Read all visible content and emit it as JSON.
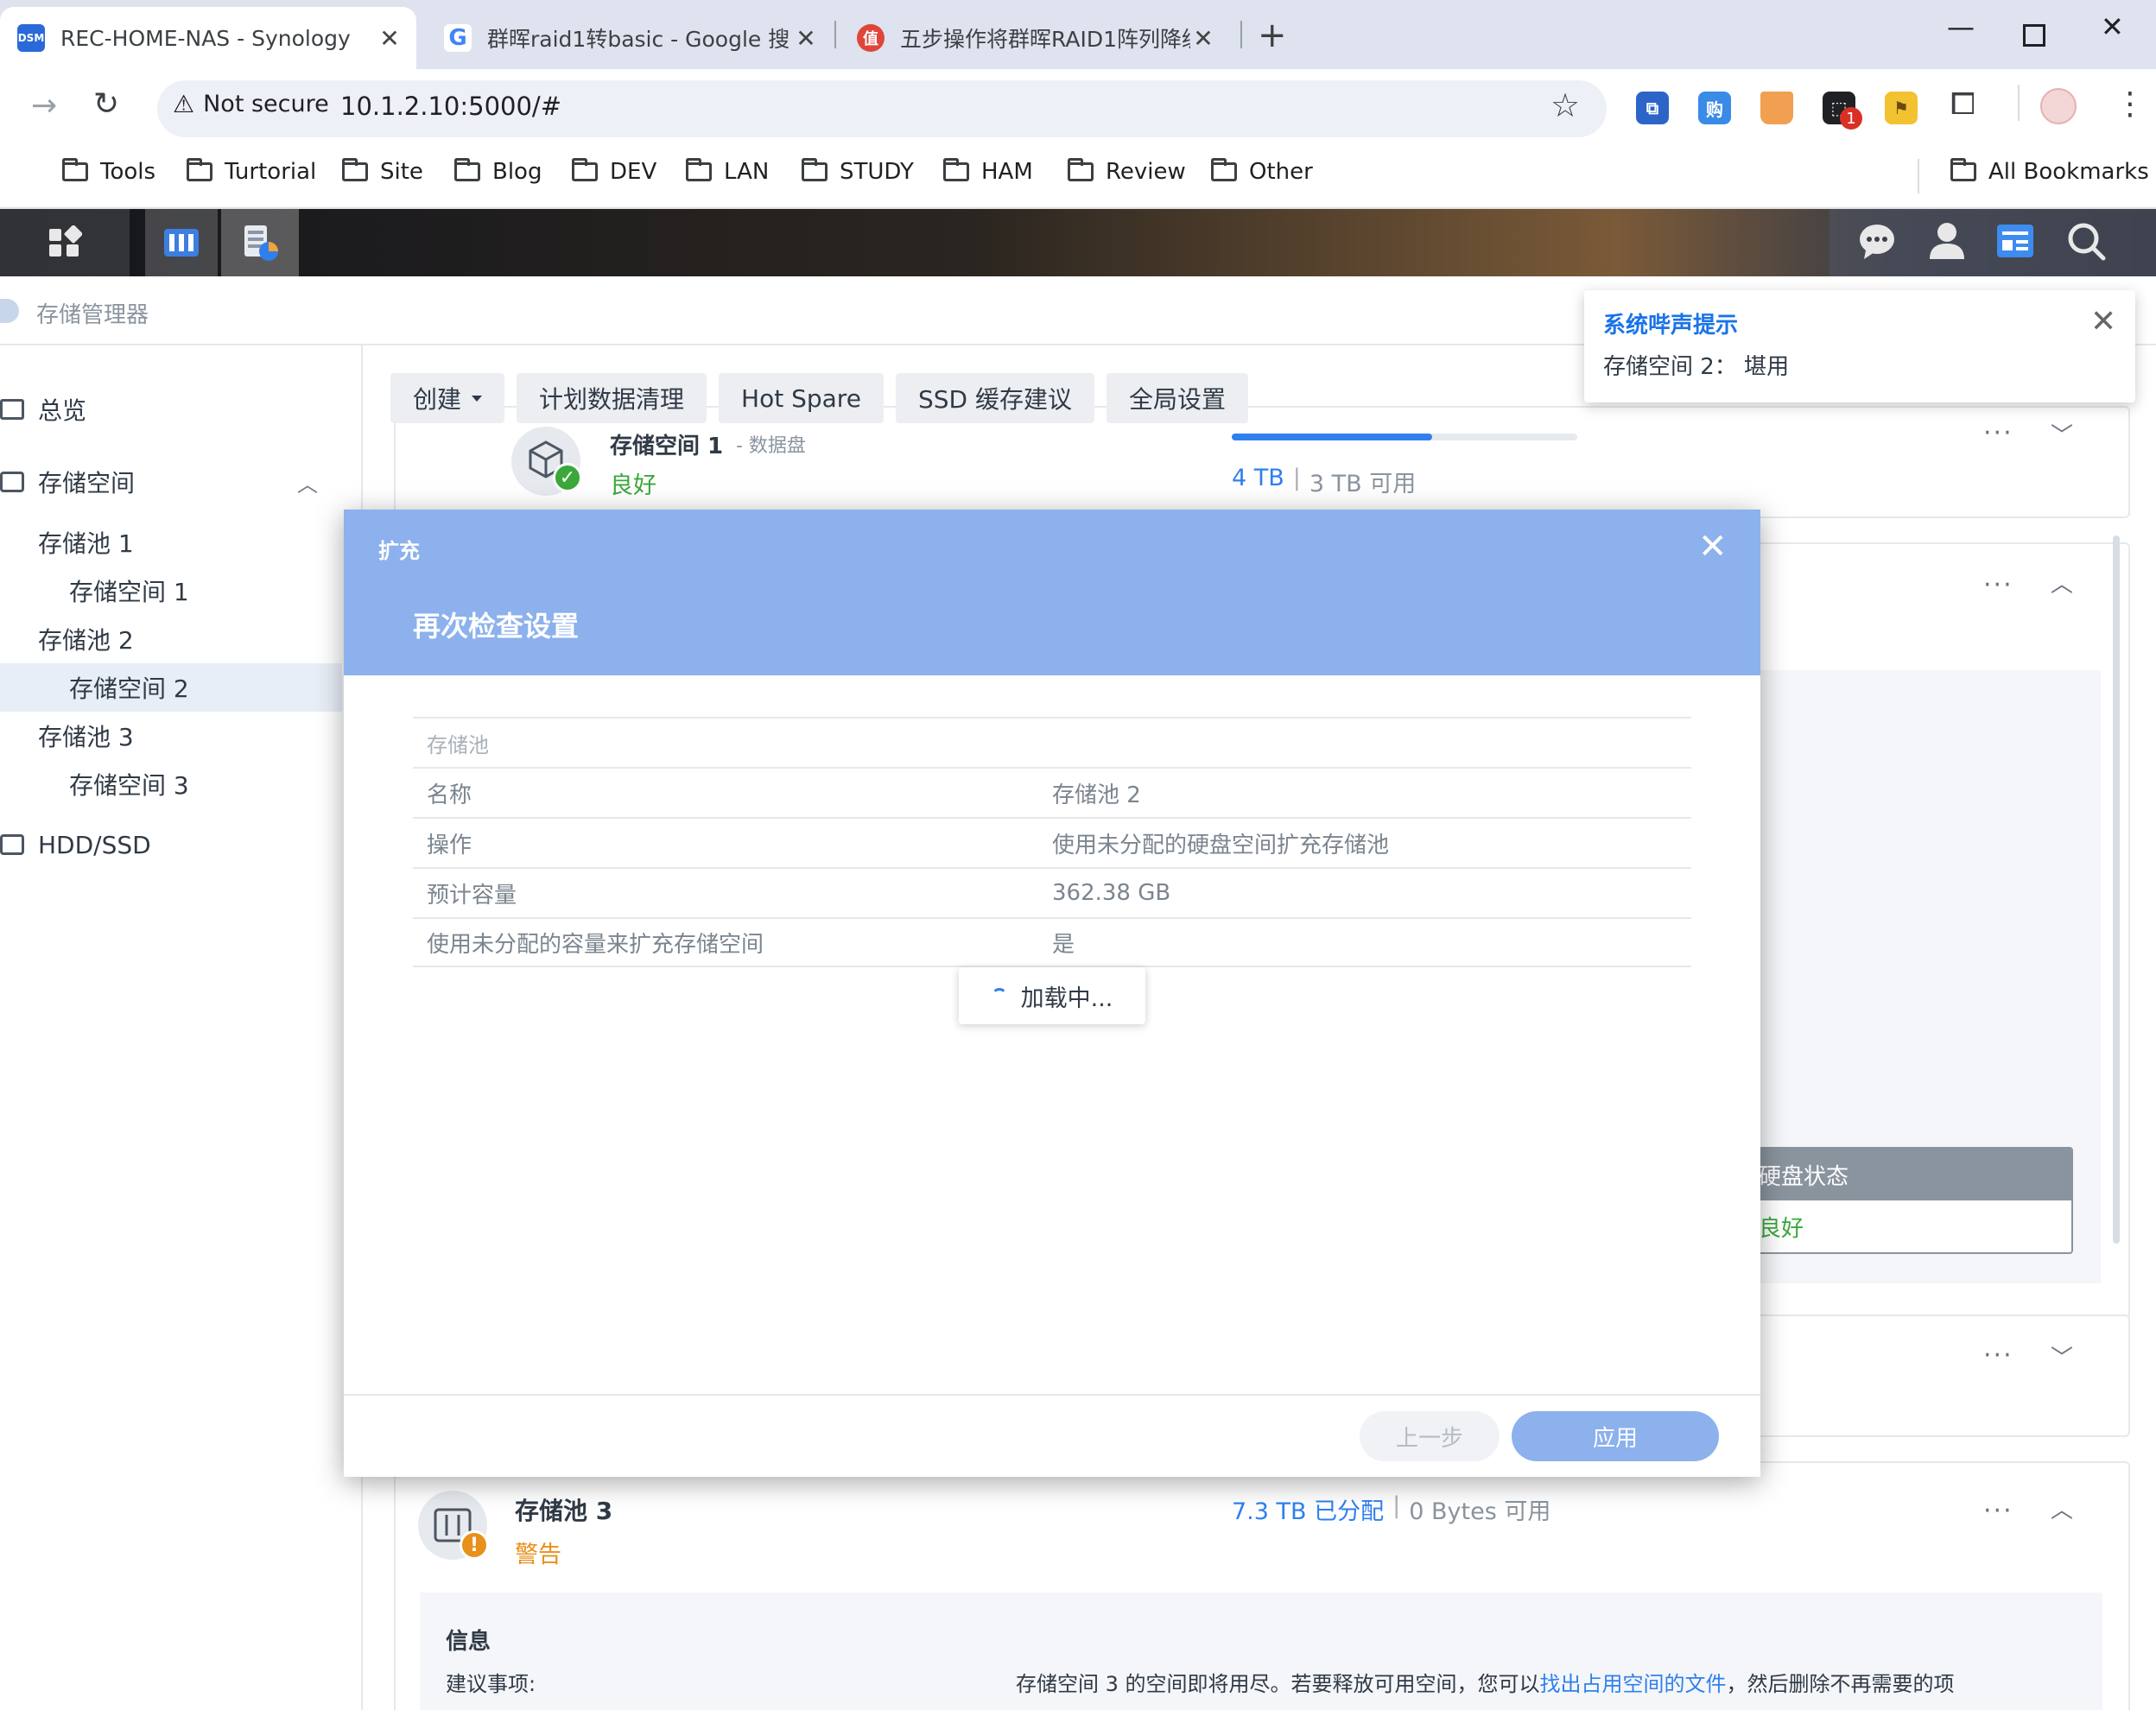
{
  "browser": {
    "tabs": [
      {
        "title": "REC-HOME-NAS - Synology",
        "favicon": "dsm-icon",
        "favicon_text": "DSM"
      },
      {
        "title": "群晖raid1转basic - Google 搜",
        "favicon": "google-icon",
        "favicon_text": "G"
      },
      {
        "title": "五步操作将群晖RAID1阵列降级",
        "favicon": "zhide-icon",
        "favicon_text": "值"
      }
    ],
    "new_tab": "+",
    "security_label": "Not secure",
    "url": "10.1.2.10:5000/#",
    "extension_badge": "1",
    "bookmarks": [
      "Tools",
      "Turtorial",
      "Site",
      "Blog",
      "DEV",
      "LAN",
      "STUDY",
      "HAM",
      "Review",
      "Other"
    ],
    "all_bookmarks": "All Bookmarks"
  },
  "app": {
    "window_title": "存储管理器",
    "sidebar": {
      "overview": "总览",
      "storage": "存储空间",
      "items": [
        {
          "label": "存储池 1",
          "level": 1
        },
        {
          "label": "存储空间 1",
          "level": 2
        },
        {
          "label": "存储池 2",
          "level": 1
        },
        {
          "label": "存储空间 2",
          "level": 2,
          "selected": true
        },
        {
          "label": "存储池 3",
          "level": 1
        },
        {
          "label": "存储空间 3",
          "level": 2
        }
      ],
      "hdd": "HDD/SSD"
    },
    "toolbar": {
      "create": "创建",
      "scrub": "计划数据清理",
      "hotspare": "Hot Spare",
      "ssd": "SSD 缓存建议",
      "global": "全局设置"
    },
    "volume1": {
      "name": "存储空间 1",
      "subtitle": "- 数据盘",
      "status": "良好",
      "capacity": "4 TB",
      "available": "3 TB 可用",
      "usage_fraction": 0.58
    },
    "disk_status": {
      "label": "硬盘状态",
      "value": "良好"
    },
    "pool3": {
      "name": "存储池 3",
      "status": "警告",
      "allocated": "7.3 TB 已分配",
      "available": "0 Bytes 可用",
      "info_title": "信息",
      "suggest_label": "建议事项:",
      "suggest_text": "存储空间 3 的空间即将用尽。若要释放可用空间，您可以",
      "suggest_link": "找出占用空间的文件",
      "suggest_tail": "，然后删除不再需要的项"
    }
  },
  "notification": {
    "title": "系统哔声提示",
    "body": "存储空间 2：  堪用"
  },
  "modal": {
    "crumb": "扩充",
    "title": "再次检查设置",
    "section": "存储池",
    "rows": [
      {
        "key": "名称",
        "value": "存储池 2"
      },
      {
        "key": "操作",
        "value": "使用未分配的硬盘空间扩充存储池"
      },
      {
        "key": "预计容量",
        "value": "362.38 GB"
      },
      {
        "key": "使用未分配的容量来扩充存储空间",
        "value": "是"
      }
    ],
    "loading": "加载中...",
    "back": "上一步",
    "apply": "应用"
  },
  "colors": {
    "accent": "#1a73e8",
    "modal_header": "#8cb1ec",
    "good": "#3aa83a",
    "warn": "#e8901a"
  }
}
